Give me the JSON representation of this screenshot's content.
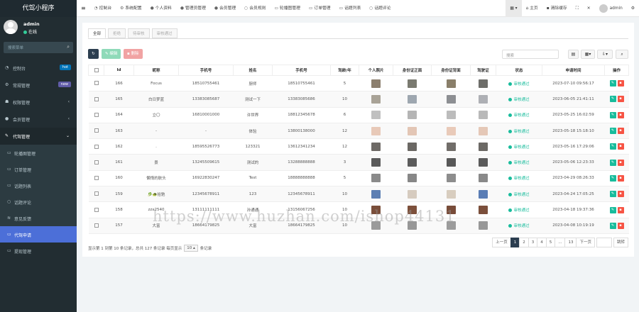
{
  "app": {
    "title": "代驾小程序"
  },
  "user": {
    "name": "admin",
    "status": "在线"
  },
  "sidebar": {
    "search_placeholder": "搜索菜单",
    "items": [
      {
        "label": "控制台",
        "badge": "hot",
        "badge_color": "#0073b7"
      },
      {
        "label": "常规管理",
        "badge": "new",
        "badge_color": "#605ca8"
      },
      {
        "label": "权限管理",
        "arrow": "‹"
      },
      {
        "label": "会员管理",
        "arrow": "‹"
      },
      {
        "label": "代驾管理",
        "arrow": "⌄"
      }
    ],
    "subitems": [
      {
        "label": "轮播图管理",
        "icon": "▭"
      },
      {
        "label": "订单管理",
        "icon": "▭"
      },
      {
        "label": "话题列表",
        "icon": "▭"
      },
      {
        "label": "话题评论",
        "icon": "○"
      },
      {
        "label": "意见反馈",
        "icon": "≋"
      },
      {
        "label": "代驾申请",
        "icon": "▭"
      }
    ],
    "last_item": {
      "label": "提现管理",
      "icon": "▭"
    }
  },
  "topnav": {
    "items": [
      {
        "label": "控制台",
        "icon": "◔"
      },
      {
        "label": "系统配置",
        "icon": "⚙"
      },
      {
        "label": "个人资料",
        "icon": "●"
      },
      {
        "label": "管理员管理",
        "icon": "●"
      },
      {
        "label": "会员管理",
        "icon": "●"
      },
      {
        "label": "会员规则",
        "icon": "○"
      },
      {
        "label": "轮播图管理",
        "icon": "▭"
      },
      {
        "label": "订单管理",
        "icon": "▭"
      },
      {
        "label": "话题列表",
        "icon": "▭"
      },
      {
        "label": "话题评论",
        "icon": "○"
      }
    ],
    "right": {
      "home": "主页",
      "clear": "清除缓存",
      "admin": "admin"
    }
  },
  "tabs": [
    "全部",
    "拒绝",
    "待审核",
    "审核通过"
  ],
  "toolbar": {
    "edit": "编辑",
    "delete": "删除",
    "search_placeholder": "搜索"
  },
  "table": {
    "headers": [
      "",
      "Id",
      "昵称",
      "手机号",
      "姓名",
      "手机号",
      "驾龄/年",
      "个人照片",
      "身份证正面",
      "身份证背面",
      "驾驶证",
      "状态",
      "申请时间",
      "操作"
    ],
    "rows": [
      {
        "id": "166",
        "nick": "Focus",
        "phone": "18510755461",
        "name": "厨师",
        "phone2": "18510755461",
        "years": "5",
        "status": "审核通过",
        "time": "2023-07-10 09:56:17",
        "imgs": [
          "#8c7f6e",
          "#7a7a70",
          "#8a7f6a",
          "#6e6e6a"
        ]
      },
      {
        "id": "165",
        "nick": "白日梦蓝",
        "phone": "13383085687",
        "name": "测试一下",
        "phone2": "13383085686",
        "years": "10",
        "status": "审核通过",
        "time": "2023-06-05 21:41:11",
        "imgs": [
          "#a9a397",
          "#9ea7b0",
          "#8d8f93",
          "#aeb0b5"
        ]
      },
      {
        "id": "164",
        "nick": "立〇",
        "phone": "16810001000",
        "name": "许世界",
        "phone2": "18812345678",
        "years": "6",
        "status": "审核通过",
        "time": "2023-05-25 16:02:59",
        "imgs": [
          "#c0c0c0",
          "#b5b5b5",
          "#bcbcbc",
          "#b9b9b9"
        ]
      },
      {
        "id": "163",
        "nick": "-",
        "phone": "-",
        "name": "体验",
        "phone2": "13800138000",
        "years": "12",
        "status": "审核通过",
        "time": "2023-05-18 15:18:10",
        "imgs": [
          "#e8c9b8",
          "#e3c6b5",
          "#e9cab9",
          "#e5c8b7"
        ]
      },
      {
        "id": "162",
        "nick": ".",
        "phone": "18595526773",
        "name": "123321",
        "phone2": "13612341234",
        "years": "12",
        "status": "审核通过",
        "time": "2023-05-16 17:29:06",
        "imgs": [
          "#6e6a66",
          "#6b6864",
          "#716d69",
          "#6c6965"
        ]
      },
      {
        "id": "161",
        "nick": "景",
        "phone": "13245509615",
        "name": "测试的",
        "phone2": "13288888888",
        "years": "3",
        "status": "审核通过",
        "time": "2023-05-06 12:23:33",
        "imgs": [
          "#5a5a5a",
          "#5c5c5c",
          "#585858",
          "#5b5b5b"
        ]
      },
      {
        "id": "160",
        "nick": "懒惰的肤头",
        "phone": "16922830247",
        "name": "Test",
        "phone2": "18888888888",
        "years": "5",
        "status": "审核通过",
        "time": "2023-04-29 08:26:33",
        "imgs": [
          "#8a8a8a",
          "#878787",
          "#8d8d8d",
          "#898989"
        ]
      },
      {
        "id": "159",
        "nick": "🥬🐢拾驰",
        "phone": "12345678911",
        "name": "123",
        "phone2": "12345678911",
        "years": "10",
        "status": "审核通过",
        "time": "2023-04-24 17:05:25",
        "imgs": [
          "#5d7fb3",
          "#d6cbbf",
          "#d8cdbf",
          "#5a7db5"
        ]
      },
      {
        "id": "158",
        "nick": "zzx2540",
        "phone": "13111111111",
        "name": "孙通通",
        "phone2": "13156067256",
        "years": "10",
        "status": "审核通过",
        "time": "2023-04-18 19:37:36",
        "imgs": [
          "#7a4e3a",
          "#7d503b",
          "#784c39",
          "#7b4f3b"
        ]
      },
      {
        "id": "157",
        "nick": "大富",
        "phone": "18664179825",
        "name": "大富",
        "phone2": "18664179825",
        "years": "10",
        "status": "审核通过",
        "time": "2023-04-08 10:19:19",
        "imgs": [
          "#9a9a9a",
          "#979797",
          "#9c9c9c",
          "#989898"
        ]
      }
    ]
  },
  "pagination": {
    "info_prefix": "显示第 1 到第 10 条记录，总共 127 条记录 每页显示",
    "per_page": "10 ▴",
    "info_suffix": "条记录",
    "prev": "上一页",
    "pages": [
      "1",
      "2",
      "3",
      "4",
      "5",
      "...",
      "13"
    ],
    "next": "下一页",
    "jump": "跳转"
  },
  "watermark": "https://www.huzhan.com/ishop44131"
}
